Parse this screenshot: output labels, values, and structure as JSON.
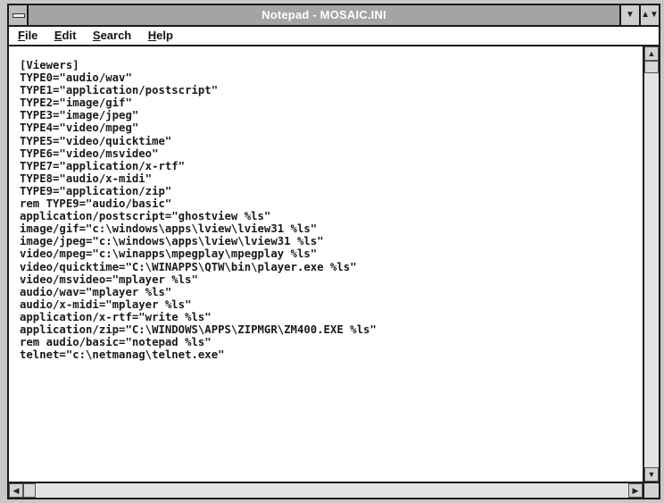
{
  "window": {
    "title": "Notepad - MOSAIC.INI"
  },
  "titlebar": {
    "system_menu_icon": "system-menu-icon",
    "minimize_icon": "minimize-icon",
    "maximize_icon": "maximize-icon"
  },
  "menubar": {
    "items": [
      {
        "label": "File",
        "mnemonic": "F"
      },
      {
        "label": "Edit",
        "mnemonic": "E"
      },
      {
        "label": "Search",
        "mnemonic": "S"
      },
      {
        "label": "Help",
        "mnemonic": "H"
      }
    ]
  },
  "editor": {
    "lines": [
      "[Viewers]",
      "TYPE0=\"audio/wav\"",
      "TYPE1=\"application/postscript\"",
      "TYPE2=\"image/gif\"",
      "TYPE3=\"image/jpeg\"",
      "TYPE4=\"video/mpeg\"",
      "TYPE5=\"video/quicktime\"",
      "TYPE6=\"video/msvideo\"",
      "TYPE7=\"application/x-rtf\"",
      "TYPE8=\"audio/x-midi\"",
      "TYPE9=\"application/zip\"",
      "rem TYPE9=\"audio/basic\"",
      "application/postscript=\"ghostview %ls\"",
      "image/gif=\"c:\\windows\\apps\\lview\\lview31 %ls\"",
      "image/jpeg=\"c:\\windows\\apps\\lview\\lview31 %ls\"",
      "video/mpeg=\"c:\\winapps\\mpegplay\\mpegplay %ls\"",
      "video/quicktime=\"C:\\WINAPPS\\QTW\\bin\\player.exe %ls\"",
      "video/msvideo=\"mplayer %ls\"",
      "audio/wav=\"mplayer %ls\"",
      "audio/x-midi=\"mplayer %ls\"",
      "application/x-rtf=\"write %ls\"",
      "application/zip=\"C:\\WINDOWS\\APPS\\ZIPMGR\\ZM400.EXE %ls\"",
      "rem audio/basic=\"notepad %ls\"",
      "telnet=\"c:\\netmanag\\telnet.exe\""
    ]
  },
  "scrollbars": {
    "up_arrow": "▲",
    "down_arrow": "▼",
    "left_arrow": "◀",
    "right_arrow": "▶"
  },
  "colors": {
    "titlebar": "#a4a4a4",
    "title_text": "#ffffff",
    "frame": "#1a1a1a"
  }
}
